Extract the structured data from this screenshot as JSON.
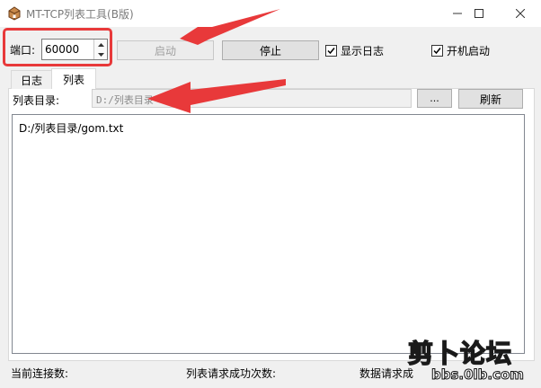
{
  "window": {
    "title": "MT-TCP列表工具(B版)",
    "controls": {
      "minimize": "minimize-icon",
      "maximize": "maximize-icon",
      "close": "close-icon"
    }
  },
  "toolbar": {
    "port_label": "端口:",
    "port_value": "60000",
    "start_label": "启动",
    "start_enabled": false,
    "stop_label": "停止",
    "show_log_label": "显示日志",
    "show_log_checked": true,
    "autostart_label": "开机启动",
    "autostart_checked": true
  },
  "tabs": [
    {
      "label": "日志",
      "active": false
    },
    {
      "label": "列表",
      "active": true
    }
  ],
  "list_tab": {
    "dir_label": "列表目录:",
    "dir_value": "D:/列表目录",
    "browse_label": "...",
    "refresh_label": "刷新",
    "content_lines": [
      "D:/列表目录/gom.txt"
    ]
  },
  "status_bar": {
    "connections_label": "当前连接数:",
    "list_requests_label": "列表请求成功次数:",
    "data_requests_label": "数据请求成"
  },
  "watermark": {
    "text": "剪卜论坛",
    "url": "bbs.0lb.com"
  },
  "colors": {
    "highlight": "#e8393a",
    "window_bg": "#f0f0f0",
    "disabled_text": "#a0a0a0"
  }
}
